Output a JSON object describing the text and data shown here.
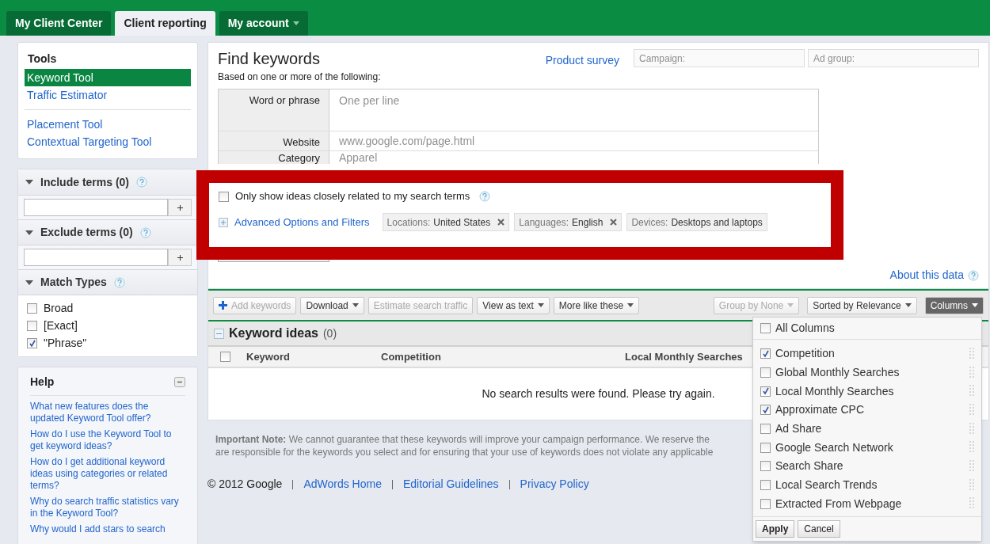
{
  "tabs": [
    {
      "label": "My Client Center",
      "selected": false,
      "has_menu": false
    },
    {
      "label": "Client reporting",
      "selected": true,
      "has_menu": false
    },
    {
      "label": "My account",
      "selected": false,
      "has_menu": true
    }
  ],
  "tools": {
    "title": "Tools",
    "groups": [
      [
        {
          "label": "Keyword Tool",
          "selected": true
        },
        {
          "label": "Traffic Estimator",
          "selected": false
        }
      ],
      [
        {
          "label": "Placement Tool",
          "selected": false
        },
        {
          "label": "Contextual Targeting Tool",
          "selected": false
        }
      ]
    ]
  },
  "include_terms": {
    "title": "Include terms (0)",
    "expanded": true
  },
  "exclude_terms": {
    "title": "Exclude terms (0)",
    "expanded": true
  },
  "match_types": {
    "title": "Match Types",
    "expanded": true,
    "options": [
      {
        "label": "Broad",
        "checked": false
      },
      {
        "label": "[Exact]",
        "checked": false
      },
      {
        "label": "\"Phrase\"",
        "checked": true
      }
    ]
  },
  "help": {
    "title": "Help",
    "links": [
      "What new features does the updated Keyword Tool offer?",
      "How do I use the Keyword Tool to get keyword ideas?",
      "How do I get additional keyword ideas using categories or related terms?",
      "Why do search traffic statistics vary in the Keyword Tool?",
      "Why would I add stars to search"
    ]
  },
  "find": {
    "title": "Find keywords",
    "subtitle": "Based on one or more of the following:",
    "survey_link": "Product survey",
    "campaign_placeholder": "Campaign:",
    "adgroup_placeholder": "Ad group:",
    "fields": [
      {
        "label": "Word or phrase",
        "placeholder": "One per line",
        "kind": "textarea"
      },
      {
        "label": "Website",
        "placeholder": "www.google.com/page.html",
        "kind": "text"
      },
      {
        "label": "Category",
        "placeholder": "Apparel",
        "kind": "select"
      }
    ]
  },
  "options": {
    "closely_related": {
      "label": "Only show ideas closely related to my search terms",
      "checked": false
    },
    "advanced_link": "Advanced Options and Filters",
    "chips": [
      {
        "name": "Locations:",
        "value": "United States",
        "removable": true
      },
      {
        "name": "Languages:",
        "value": "English",
        "removable": true
      },
      {
        "name": "Devices:",
        "value": "Desktops and laptops",
        "removable": false
      }
    ]
  },
  "about_link": "About this data",
  "toolbar": {
    "left": [
      {
        "label": "Add keywords",
        "disabled": true,
        "has_menu": false,
        "kind": "add"
      },
      {
        "label": "Download",
        "disabled": false,
        "has_menu": true,
        "kind": "plain"
      },
      {
        "label": "Estimate search traffic",
        "disabled": true,
        "has_menu": false,
        "kind": "plain"
      },
      {
        "label": "View as text",
        "disabled": false,
        "has_menu": true,
        "kind": "plain"
      },
      {
        "label": "More like these",
        "disabled": false,
        "has_menu": true,
        "kind": "plain"
      }
    ],
    "right": [
      {
        "label": "Group by None",
        "disabled": true,
        "has_menu": true,
        "selected": false
      },
      {
        "label": "Sorted by Relevance",
        "disabled": false,
        "has_menu": true,
        "selected": false
      },
      {
        "label": "Columns",
        "disabled": false,
        "has_menu": true,
        "selected": true
      }
    ]
  },
  "results": {
    "title": "Keyword ideas",
    "count": "(0)",
    "expanded": true,
    "header_checked": false,
    "columns": [
      "Keyword",
      "Competition",
      "Local Monthly Searches"
    ],
    "empty_message": "No search results were found. Please try again."
  },
  "note": {
    "label": "Important Note:",
    "text": "We cannot guarantee that these keywords will improve your campaign performance. We reserve the",
    "line2": "are responsible for the keywords you select and for ensuring that your use of keywords does not violate any applicable"
  },
  "footer": {
    "copyright": "© 2012 Google",
    "links": [
      "AdWords Home",
      "Editorial Guidelines",
      "Privacy Policy"
    ]
  },
  "columns_menu": {
    "all": {
      "label": "All Columns",
      "checked": false
    },
    "items": [
      {
        "label": "Competition",
        "checked": true
      },
      {
        "label": "Global Monthly Searches",
        "checked": false
      },
      {
        "label": "Local Monthly Searches",
        "checked": true
      },
      {
        "label": "Approximate CPC",
        "checked": true
      },
      {
        "label": "Ad Share",
        "checked": false
      },
      {
        "label": "Google Search Network",
        "checked": false
      },
      {
        "label": "Search Share",
        "checked": false
      },
      {
        "label": "Local Search Trends",
        "checked": false
      },
      {
        "label": "Extracted From Webpage",
        "checked": false
      }
    ],
    "apply": "Apply",
    "cancel": "Cancel"
  }
}
